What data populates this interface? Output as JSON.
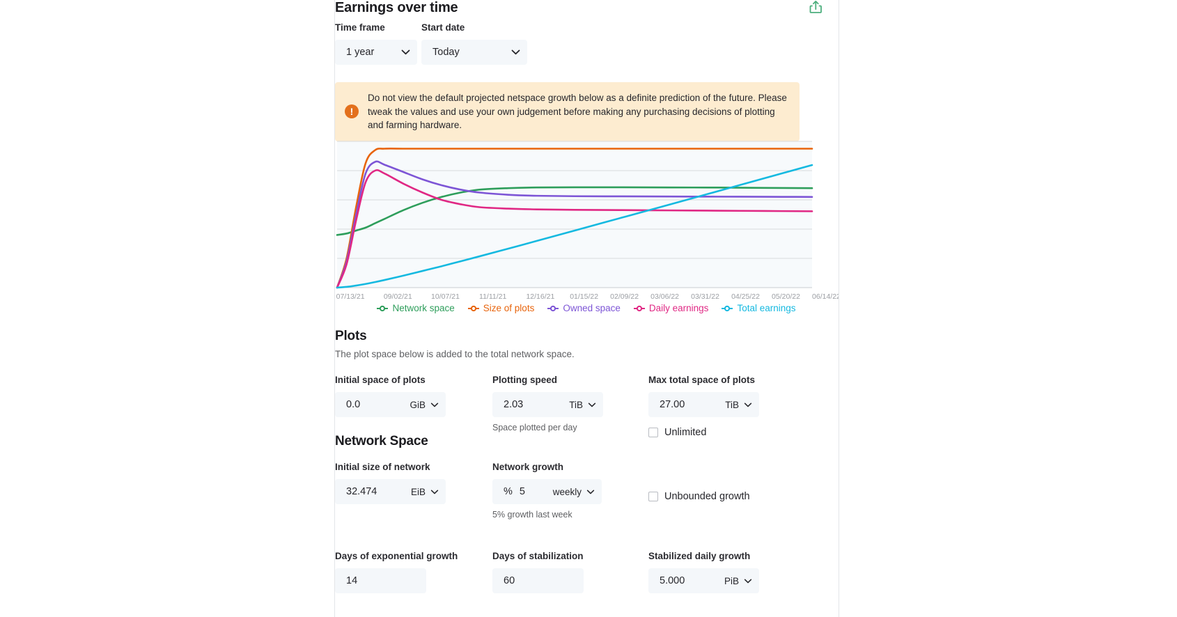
{
  "header": {
    "title": "Earnings over time",
    "share_icon": "share-export-icon",
    "share_color": "#4caf7d"
  },
  "controls": {
    "time_frame": {
      "label": "Time frame",
      "value": "1 year"
    },
    "start_date": {
      "label": "Start date",
      "value": "Today"
    }
  },
  "alert": {
    "icon": "!",
    "text": "Do not view the default projected netspace growth below as a definite prediction of the future. Please tweak the values and use your own judgement before making any purchasing decisions of plotting and farming hardware."
  },
  "chart_data": {
    "type": "line",
    "title": "Earnings over time",
    "xlabel": "",
    "ylabel": "",
    "grid": true,
    "legend_position": "bottom",
    "x_tick_labels": [
      "07/13/21",
      "09/02/21",
      "10/07/21",
      "11/11/21",
      "12/16/21",
      "01/15/22",
      "02/09/22",
      "03/06/22",
      "03/31/22",
      "04/25/22",
      "05/20/22",
      "06/14/22"
    ],
    "x": [
      0,
      0.02,
      0.04,
      0.06,
      0.08,
      0.1,
      0.14,
      0.18,
      0.22,
      0.26,
      0.3,
      0.36,
      0.42,
      0.5,
      0.6,
      0.7,
      0.8,
      0.9,
      1.0
    ],
    "ylim": [
      0,
      100
    ],
    "series": [
      {
        "name": "Network space",
        "color": "#2e9e5b",
        "values": [
          36,
          37,
          39,
          41,
          44,
          47,
          53,
          58,
          62,
          65,
          67,
          68,
          68.5,
          68.6,
          68.6,
          68.5,
          68.4,
          68.2,
          68.0
        ]
      },
      {
        "name": "Size of plots",
        "color": "#e8640c",
        "values": [
          0,
          20,
          55,
          85,
          94,
          95,
          95,
          95,
          95,
          95,
          95,
          95,
          95,
          95,
          95,
          95,
          95,
          95,
          95
        ]
      },
      {
        "name": "Owned space",
        "color": "#7d55d6",
        "values": [
          0,
          18,
          50,
          78,
          86,
          84,
          79,
          74,
          70,
          67,
          65,
          63.5,
          62.8,
          62.5,
          62.4,
          62.3,
          62.2,
          62.1,
          62.0
        ]
      },
      {
        "name": "Daily earnings",
        "color": "#e02884",
        "values": [
          0,
          16,
          46,
          72,
          80,
          78,
          71,
          65,
          60,
          57,
          55,
          54,
          53.5,
          53.2,
          53.0,
          52.8,
          52.6,
          52.4,
          52.2
        ]
      },
      {
        "name": "Total earnings",
        "color": "#15b9e0",
        "values": [
          0,
          0.5,
          1.4,
          2.5,
          3.8,
          5.2,
          8.2,
          11.4,
          14.6,
          18,
          21.4,
          26.6,
          31.9,
          39,
          47.9,
          56.8,
          65.8,
          74.8,
          83.8
        ]
      }
    ]
  },
  "legend": [
    {
      "label": "Network space",
      "color": "#2e9e5b"
    },
    {
      "label": "Size of plots",
      "color": "#e8640c"
    },
    {
      "label": "Owned space",
      "color": "#7d55d6"
    },
    {
      "label": "Daily earnings",
      "color": "#e02884"
    },
    {
      "label": "Total earnings",
      "color": "#15b9e0"
    }
  ],
  "plots": {
    "title": "Plots",
    "subtitle": "The plot space below is added to the total network space.",
    "initial_space": {
      "label": "Initial space of plots",
      "value": "0.0",
      "unit": "GiB"
    },
    "plotting_speed": {
      "label": "Plotting speed",
      "value": "2.03",
      "unit": "TiB",
      "helper": "Space plotted per day"
    },
    "max_total_space": {
      "label": "Max total space of plots",
      "value": "27.00",
      "unit": "TiB",
      "checkbox_label": "Unlimited"
    }
  },
  "network_space": {
    "title": "Network Space",
    "initial_size": {
      "label": "Initial size of network",
      "value": "32.474",
      "unit": "EiB"
    },
    "network_growth": {
      "label": "Network growth",
      "prefix": "%",
      "value": "5",
      "period": "weekly",
      "helper": "5% growth last week",
      "checkbox_label": "Unbounded growth"
    },
    "days_exponential": {
      "label": "Days of exponential growth",
      "value": "14"
    },
    "days_stabilization": {
      "label": "Days of stabilization",
      "value": "60"
    },
    "stabilized_daily_growth": {
      "label": "Stabilized daily growth",
      "value": "5.000",
      "unit": "PiB"
    }
  }
}
